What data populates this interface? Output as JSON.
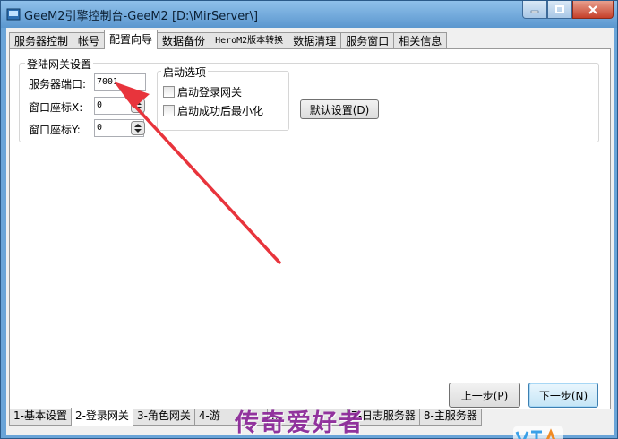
{
  "window": {
    "title": "GeeM2引擎控制台-GeeM2 [D:\\MirServer\\]"
  },
  "tabs_top": [
    "服务器控制",
    "帐号",
    "配置向导",
    "数据备份",
    "HeroM2版本转换",
    "数据清理",
    "服务窗口",
    "相关信息"
  ],
  "login_gateway": {
    "group_title": "登陆网关设置",
    "port_label": "服务器端口:",
    "port_value": "7001",
    "window_x_label": "窗口座标X:",
    "window_x_value": "0",
    "window_y_label": "窗口座标Y:",
    "window_y_value": "0",
    "startup_title": "启动选项",
    "start_gateway": "启动登录网关",
    "minimize_after_start": "启动成功后最小化",
    "default_button": "默认设置(D)"
  },
  "nav": {
    "prev": "上一步(P)",
    "next": "下一步(N)"
  },
  "tabs_bottom": [
    "1-基本设置",
    "2-登录网关",
    "3-角色网关",
    "4-游",
    "...",
    "7-日志服务器",
    "8-主服务器"
  ],
  "watermark": "传奇爱好者",
  "colors": {
    "arrow": "#e8343c",
    "watermark": "#8a2597",
    "title_bar": "#6aa4d8"
  }
}
